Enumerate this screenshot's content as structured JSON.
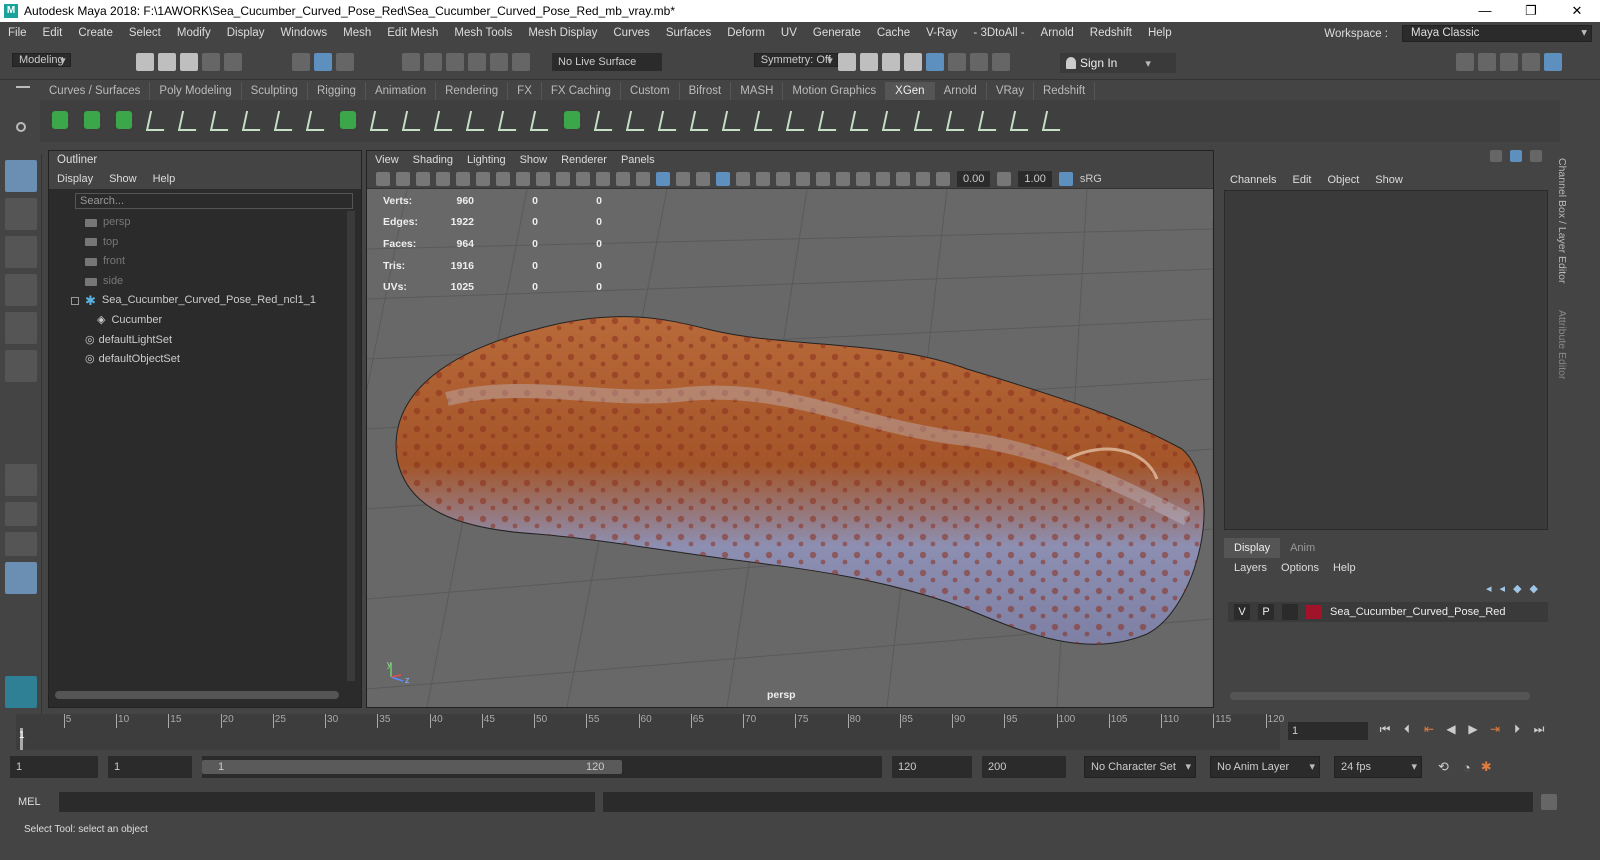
{
  "window": {
    "title": "Autodesk Maya 2018: F:\\1AWORK\\Sea_Cucumber_Curved_Pose_Red\\Sea_Cucumber_Curved_Pose_Red_mb_vray.mb*",
    "logo": "M",
    "minimize": "—",
    "restore": "❐",
    "close": "✕"
  },
  "menubar": {
    "items": [
      "File",
      "Edit",
      "Create",
      "Select",
      "Modify",
      "Display",
      "Windows",
      "Mesh",
      "Edit Mesh",
      "Mesh Tools",
      "Mesh Display",
      "Curves",
      "Surfaces",
      "Deform",
      "UV",
      "Generate",
      "Cache",
      "V-Ray",
      "- 3DtoAll -",
      "Arnold",
      "Redshift",
      "Help"
    ],
    "workspace_label": "Workspace :",
    "workspace_value": "Maya Classic"
  },
  "statusline": {
    "mode": "Modeling",
    "live_surface": "No Live Surface",
    "symmetry": "Symmetry: Off",
    "sign_in": "Sign In"
  },
  "shelf": {
    "tabs": [
      "Curves / Surfaces",
      "Poly Modeling",
      "Sculpting",
      "Rigging",
      "Animation",
      "Rendering",
      "FX",
      "FX Caching",
      "Custom",
      "Bifrost",
      "MASH",
      "Motion Graphics",
      "XGen",
      "Arnold",
      "VRay",
      "Redshift"
    ],
    "active_tab": "XGen"
  },
  "outliner": {
    "title": "Outliner",
    "menu": [
      "Display",
      "Show",
      "Help"
    ],
    "search_placeholder": "Search...",
    "items": [
      {
        "label": "persp",
        "kind": "camera",
        "indent": 1
      },
      {
        "label": "top",
        "kind": "camera",
        "indent": 1
      },
      {
        "label": "front",
        "kind": "camera",
        "indent": 1
      },
      {
        "label": "side",
        "kind": "camera",
        "indent": 1
      },
      {
        "label": "Sea_Cucumber_Curved_Pose_Red_ncl1_1",
        "kind": "group",
        "indent": 0
      },
      {
        "label": "Cucumber",
        "kind": "mesh",
        "indent": 2
      },
      {
        "label": "defaultLightSet",
        "kind": "set",
        "indent": 1
      },
      {
        "label": "defaultObjectSet",
        "kind": "set",
        "indent": 1
      }
    ]
  },
  "viewport": {
    "menu": [
      "View",
      "Shading",
      "Lighting",
      "Show",
      "Renderer",
      "Panels"
    ],
    "field_a": "0.00",
    "field_b": "1.00",
    "color_space": "sRG",
    "hud": [
      {
        "label": "Verts:",
        "v": "960",
        "a": "0",
        "b": "0"
      },
      {
        "label": "Edges:",
        "v": "1922",
        "a": "0",
        "b": "0"
      },
      {
        "label": "Faces:",
        "v": "964",
        "a": "0",
        "b": "0"
      },
      {
        "label": "Tris:",
        "v": "1916",
        "a": "0",
        "b": "0"
      },
      {
        "label": "UVs:",
        "v": "1025",
        "a": "0",
        "b": "0"
      }
    ],
    "camera_label": "persp",
    "axis_y": "y",
    "axis_z": "z"
  },
  "channelbox": {
    "menu": [
      "Channels",
      "Edit",
      "Object",
      "Show"
    ],
    "side_tabs": [
      "Channel Box / Layer Editor",
      "Attribute Editor"
    ]
  },
  "layereditor": {
    "tabs": [
      "Display",
      "Anim"
    ],
    "active_tab": "Display",
    "menu": [
      "Layers",
      "Options",
      "Help"
    ],
    "layer": {
      "v": "V",
      "p": "P",
      "name": "Sea_Cucumber_Curved_Pose_Red",
      "color": "#a01328"
    }
  },
  "timeline": {
    "ticks": [
      "5",
      "10",
      "15",
      "20",
      "25",
      "30",
      "35",
      "40",
      "45",
      "50",
      "55",
      "60",
      "65",
      "70",
      "75",
      "80",
      "85",
      "90",
      "95",
      "100",
      "105",
      "110",
      "115",
      "120"
    ],
    "current_marker": "1",
    "current_frame": "1"
  },
  "range": {
    "start": "1",
    "playback_start": "1",
    "slider_start": "1",
    "slider_end": "120",
    "playback_end": "120",
    "end": "200",
    "character_set": "No Character Set",
    "anim_layer": "No Anim Layer",
    "fps": "24 fps"
  },
  "cmdline": {
    "label": "MEL"
  },
  "helpline": {
    "text": "Select Tool: select an object"
  }
}
